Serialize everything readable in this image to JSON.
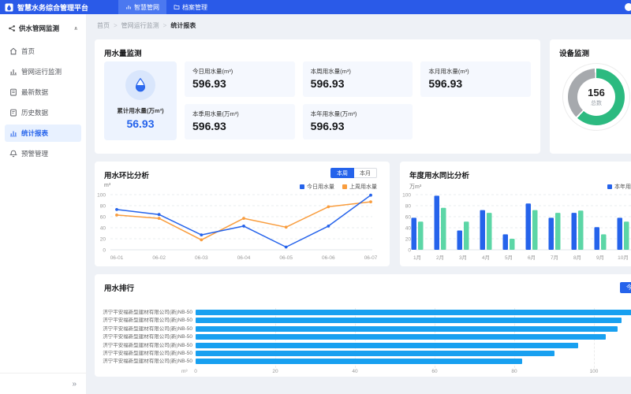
{
  "topbar": {
    "brand": "智慧水务综合管理平台",
    "logo_icon": "water-logo-icon",
    "nav": [
      {
        "label": "智慧管网",
        "icon": "chart-icon",
        "active": true
      },
      {
        "label": "档案管理",
        "icon": "folder-icon",
        "active": false
      }
    ]
  },
  "sidebar": {
    "group": {
      "label": "供水管网监测",
      "icon": "pipe-network-icon",
      "collapse_glyph": "∧"
    },
    "items": [
      {
        "label": "首页",
        "icon": "home-icon",
        "active": false
      },
      {
        "label": "管网运行监测",
        "icon": "monitor-icon",
        "active": false
      },
      {
        "label": "最新数据",
        "icon": "latest-data-icon",
        "active": false
      },
      {
        "label": "历史数据",
        "icon": "history-data-icon",
        "active": false
      },
      {
        "label": "统计报表",
        "icon": "report-icon",
        "active": true
      },
      {
        "label": "预警管理",
        "icon": "alert-icon",
        "active": false
      }
    ],
    "collapse": "»"
  },
  "breadcrumb": [
    "首页",
    "管网运行监测",
    "统计报表"
  ],
  "water_panel": {
    "title": "用水量监测",
    "summary": {
      "label": "累计用水量(万m³)",
      "value": "56.93",
      "icon": "water-drop-icon"
    },
    "stats": [
      {
        "label": "今日用水量(m³)",
        "value": "596.93"
      },
      {
        "label": "本周用水量(m³)",
        "value": "596.93"
      },
      {
        "label": "本月用水量(m³)",
        "value": "596.93"
      },
      {
        "label": "本季用水量(万m³)",
        "value": "596.93"
      },
      {
        "label": "本年用水量(万m³)",
        "value": "596.93"
      }
    ]
  },
  "device_panel": {
    "title": "设备监测",
    "total": "156",
    "total_label": "总数"
  },
  "trend_panel": {
    "title": "用水环比分析",
    "unit": "m³",
    "toggles": [
      {
        "label": "本周",
        "active": true
      },
      {
        "label": "本月",
        "active": false
      }
    ]
  },
  "year_panel": {
    "title": "年度用水同比分析",
    "unit": "万m³",
    "legend": "本年用水量"
  },
  "ranking_panel": {
    "title": "用水排行",
    "button": "今日",
    "unit": "m³"
  },
  "chart_data": [
    {
      "id": "weekly_trend",
      "type": "line",
      "title": "用水环比分析",
      "unit": "m³",
      "x": [
        "06-01",
        "06-02",
        "06-03",
        "06-04",
        "06-05",
        "06-06",
        "06-07"
      ],
      "series": [
        {
          "name": "今日用水量",
          "color": "#2563EB",
          "values": [
            73,
            64,
            27,
            43,
            5,
            43,
            99
          ]
        },
        {
          "name": "上周用水量",
          "color": "#F99D3E",
          "values": [
            63,
            57,
            18,
            57,
            41,
            78,
            87
          ]
        }
      ],
      "ylim": [
        0,
        100
      ],
      "yticks": [
        0,
        20,
        40,
        60,
        80,
        100
      ],
      "grid": "dashed-horizontal",
      "legend_position": "top-right"
    },
    {
      "id": "yearly_compare",
      "type": "bar",
      "title": "年度用水同比分析",
      "unit": "万m³",
      "categories": [
        "1月",
        "2月",
        "3月",
        "4月",
        "5月",
        "6月",
        "7月",
        "8月",
        "9月",
        "10月"
      ],
      "series": [
        {
          "name": "本年用水量",
          "color": "#2563EB",
          "values": [
            58,
            98,
            35,
            72,
            28,
            84,
            58,
            67,
            41,
            58
          ]
        },
        {
          "name": "",
          "color": "#5CD6A6",
          "values": [
            51,
            76,
            51,
            67,
            20,
            72,
            67,
            71,
            28,
            51
          ]
        }
      ],
      "ylim": [
        0,
        100
      ],
      "yticks": [
        0,
        20,
        40,
        60,
        80,
        100
      ],
      "grid": "dashed-horizontal"
    },
    {
      "id": "device_donut",
      "type": "donut",
      "title": "设备监测",
      "center_value": "156",
      "center_label": "总数",
      "segments": [
        {
          "name": "segment-green",
          "color": "#2CBA80",
          "percent": 62.5
        },
        {
          "name": "segment-gray",
          "color": "#A6A9AD",
          "percent": 37.5
        }
      ]
    },
    {
      "id": "usage_ranking",
      "type": "hbar",
      "title": "用水排行",
      "unit": "m³",
      "categories": [
        "济宁平安福新型建材有限公司(新)NB-50",
        "济宁平安福新型建材有限公司(新)NB-50",
        "济宁平安福新型建材有限公司(新)NB-50",
        "济宁平安福新型建材有限公司(新)NB-50",
        "济宁平安福新型建材有限公司(新)NB-50",
        "济宁平安福新型建材有限公司(新)NB-50",
        "济宁平安福新型建材有限公司(新)NB-50"
      ],
      "values": [
        112,
        107,
        106,
        103,
        96,
        90,
        82
      ],
      "xticks": [
        0,
        20,
        40,
        60,
        80,
        100
      ],
      "bar_color": "#18A0F0"
    }
  ],
  "colors": {
    "accent": "#2563EB",
    "topbar": "#2A5AE8",
    "line_blue": "#2563EB",
    "line_orange": "#F99D3E",
    "bar_green": "#5CD6A6",
    "donut_green": "#2CBA80",
    "donut_gray": "#A6A9AD",
    "rank_blue": "#18A0F0"
  }
}
